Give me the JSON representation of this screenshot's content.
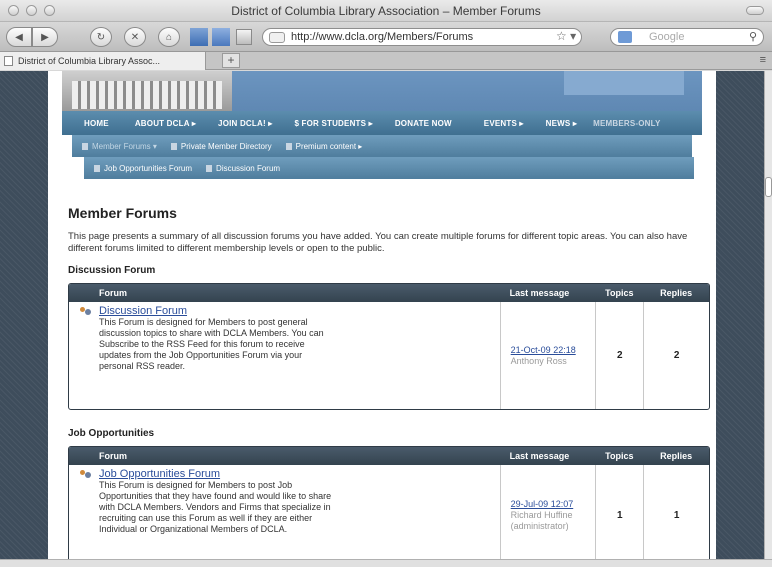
{
  "window": {
    "title": "District of Columbia Library Association – Member Forums"
  },
  "toolbar": {
    "url": "http://www.dcla.org/Members/Forums",
    "search_placeholder": "Google"
  },
  "tab": {
    "title": "District of Columbia Library Assoc..."
  },
  "main_nav": [
    {
      "label": "HOME"
    },
    {
      "label": "ABOUT DCLA ▸"
    },
    {
      "label": "JOIN DCLA! ▸"
    },
    {
      "label": "$ FOR STUDENTS ▸"
    },
    {
      "label": "DONATE NOW"
    },
    {
      "label": "EVENTS ▸"
    },
    {
      "label": "NEWS ▸"
    },
    {
      "label": "MEMBERS-ONLY"
    }
  ],
  "sub_nav": [
    {
      "label": "Member Forums ▾"
    },
    {
      "label": "Private Member Directory"
    },
    {
      "label": "Premium content ▸"
    }
  ],
  "sub_nav2": [
    {
      "label": "Job Opportunities Forum"
    },
    {
      "label": "Discussion Forum"
    }
  ],
  "page": {
    "title": "Member Forums",
    "intro": "This page presents a summary of all discussion forums you have added.  You can create multiple forums for different topic areas. You can also have different forums limited to different membership levels or open to the public."
  },
  "table_headers": {
    "forum": "Forum",
    "last_message": "Last message",
    "topics": "Topics",
    "replies": "Replies"
  },
  "sections": [
    {
      "heading": "Discussion Forum",
      "forum": {
        "name": "Discussion Forum",
        "description": "This Forum is designed for Members to post general discussion topics to share with DCLA Members. You can Subscribe to the RSS Feed for this forum to receive updates from the Job Opportunities Forum via your personal RSS reader.",
        "last_date": "21-Oct-09 22:18",
        "last_by": "Anthony Ross",
        "topics": "2",
        "replies": "2"
      }
    },
    {
      "heading": "Job Opportunities",
      "forum": {
        "name": "Job Opportunities Forum",
        "description": "This Forum is designed for Members to post Job Opportunities that they have found and would like to share with DCLA Members. Vendors and Firms that specialize in recruiting can use this Forum as well if they are either Individual or Organizational Members of DCLA.",
        "last_date": "29-Jul-09 12:07",
        "last_by": "Richard Huffine (administrator)",
        "topics": "1",
        "replies": "1"
      }
    }
  ]
}
